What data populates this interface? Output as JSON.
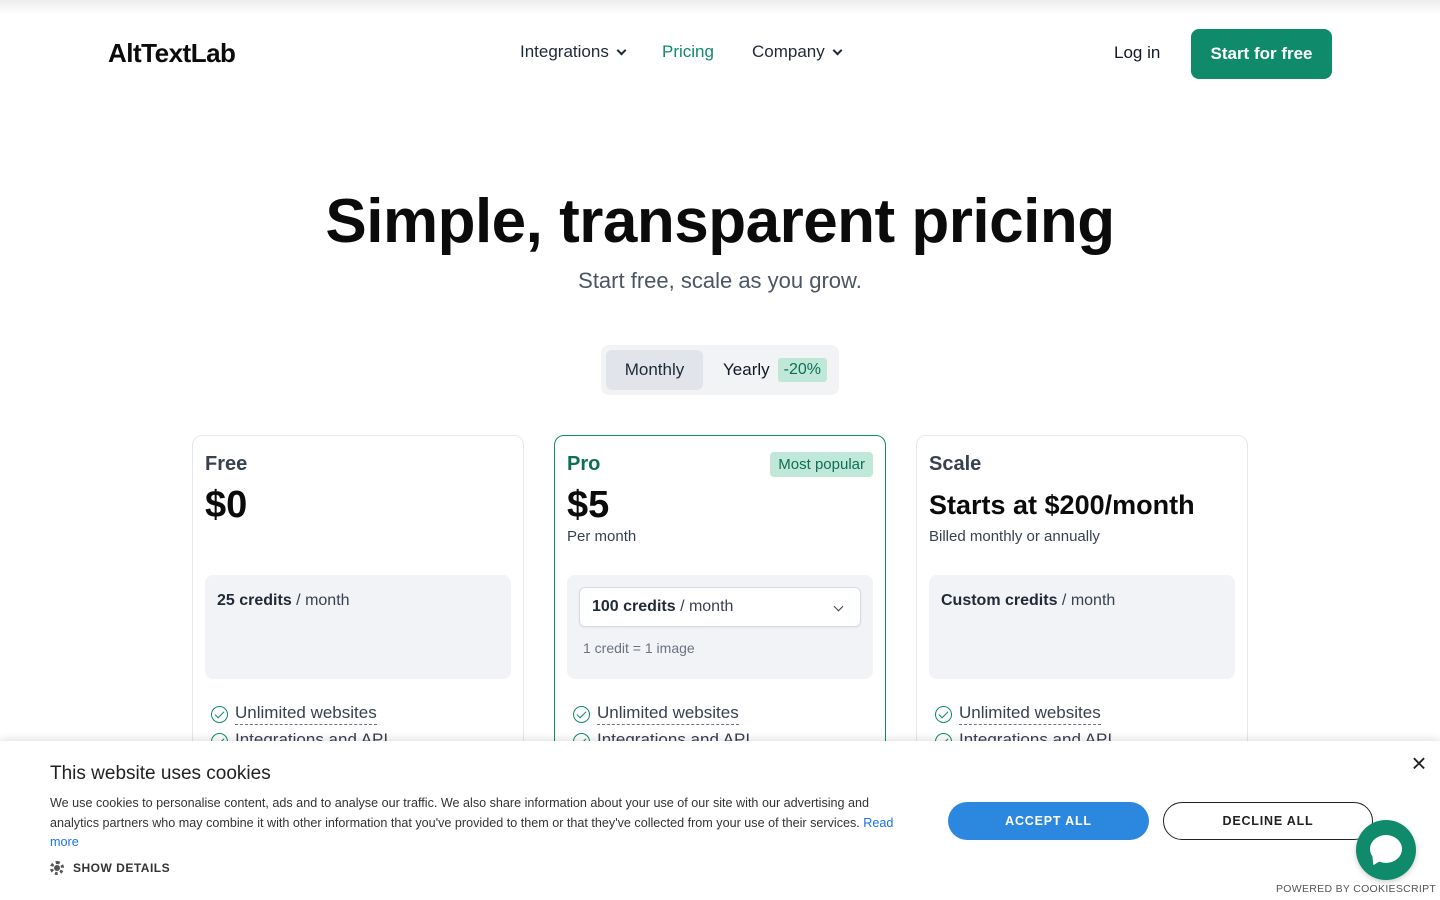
{
  "nav": {
    "logo": "AltTextLab",
    "links": {
      "integrations": "Integrations",
      "pricing": "Pricing",
      "company": "Company"
    },
    "login": "Log in",
    "cta": "Start for free"
  },
  "hero": {
    "title": "Simple, transparent pricing",
    "subtitle": "Start free, scale as you grow."
  },
  "billing_toggle": {
    "monthly": "Monthly",
    "yearly": "Yearly",
    "discount": "-20%",
    "selected": "Monthly"
  },
  "plans": {
    "free": {
      "name": "Free",
      "price": "$0",
      "credits_amount": "25 credits",
      "credits_period": "/ month",
      "features": [
        "Unlimited websites",
        "Integrations and API"
      ]
    },
    "pro": {
      "name": "Pro",
      "badge": "Most popular",
      "price": "$5",
      "price_sub": "Per month",
      "credits_amount": "100 credits",
      "credits_period": "/ month",
      "credit_note": "1 credit = 1 image",
      "features": [
        "Unlimited websites",
        "Integrations and API"
      ]
    },
    "scale": {
      "name": "Scale",
      "price": "Starts at $200/month",
      "price_sub": "Billed monthly or annually",
      "credits_amount": "Custom credits",
      "credits_period": "/ month",
      "features": [
        "Unlimited websites",
        "Integrations and API"
      ]
    }
  },
  "cookie_banner": {
    "title": "This website uses cookies",
    "text": "We use cookies to personalise content, ads and to analyse our traffic. We also share information about your use of our site with our advertising and analytics partners who may combine it with other information that you've provided to them or that they've collected from your use of their services.",
    "read_more": "Read more",
    "show_details": "SHOW DETAILS",
    "accept": "ACCEPT ALL",
    "decline": "DECLINE ALL",
    "close": "×",
    "powered_by": "POWERED BY COOKIESCRIPT"
  },
  "colors": {
    "brand_green": "#0f8a6a",
    "accept_blue": "#2c87de",
    "badge_bg": "#bfe8d9"
  }
}
